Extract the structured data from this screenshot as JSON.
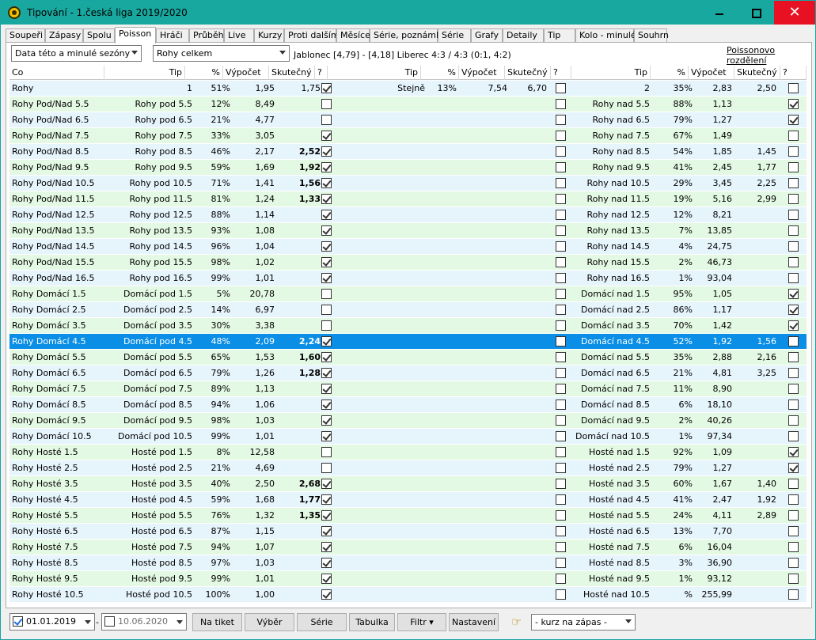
{
  "window": {
    "title": "Tipování - 1.česká liga 2019/2020",
    "minimize": "",
    "maximize": "",
    "close": "✕"
  },
  "tabs": [
    "Soupeři",
    "Zápasy",
    "Spolu",
    "Poisson",
    "Hráči",
    "Průběh",
    "Live",
    "Kurzy",
    "Proti dalším",
    "Měsíce",
    "Série, poznámky",
    "Série",
    "Grafy",
    "Detaily",
    "Tip",
    "Kolo - minulé",
    "Souhrn"
  ],
  "active_tab": "Poisson",
  "filters": {
    "data_source": "Data této a minulé sezóny",
    "market": "Rohy celkem",
    "match_info": "Jablonec [4,79] - [4,18] Liberec  4:3 / 4:3 (0:1, 4:2)",
    "poisson_link": "Poissonovo rozdělení"
  },
  "grid_headers": {
    "co": "Co",
    "tip": "Tip",
    "pct": "%",
    "calc": "Výpočet",
    "actual": "Skutečný",
    "q": "?"
  },
  "rows": [
    [
      "Rohy",
      "1",
      "51%",
      "1,95",
      "1,75",
      1,
      0,
      "Stejně",
      "13%",
      "7,54",
      "6,70",
      0,
      "2",
      "35%",
      "2,83",
      "2,50",
      0,
      0
    ],
    [
      "Rohy Pod/Nad 5.5",
      "Rohy pod 5.5",
      "12%",
      "8,49",
      "",
      0,
      0,
      "",
      "",
      "",
      "",
      0,
      "Rohy nad 5.5",
      "88%",
      "1,13",
      "",
      1,
      0
    ],
    [
      "Rohy Pod/Nad 6.5",
      "Rohy pod 6.5",
      "21%",
      "4,77",
      "",
      0,
      0,
      "",
      "",
      "",
      "",
      0,
      "Rohy nad 6.5",
      "79%",
      "1,27",
      "",
      1,
      0
    ],
    [
      "Rohy Pod/Nad 7.5",
      "Rohy pod 7.5",
      "33%",
      "3,05",
      "",
      1,
      0,
      "",
      "",
      "",
      "",
      0,
      "Rohy nad 7.5",
      "67%",
      "1,49",
      "",
      0,
      0
    ],
    [
      "Rohy Pod/Nad 8.5",
      "Rohy pod 8.5",
      "46%",
      "2,17",
      "2,52",
      1,
      1,
      "",
      "",
      "",
      "",
      0,
      "Rohy nad 8.5",
      "54%",
      "1,85",
      "1,45",
      0,
      0
    ],
    [
      "Rohy Pod/Nad 9.5",
      "Rohy pod 9.5",
      "59%",
      "1,69",
      "1,92",
      1,
      1,
      "",
      "",
      "",
      "",
      0,
      "Rohy nad 9.5",
      "41%",
      "2,45",
      "1,77",
      0,
      0
    ],
    [
      "Rohy Pod/Nad 10.5",
      "Rohy pod 10.5",
      "71%",
      "1,41",
      "1,56",
      1,
      1,
      "",
      "",
      "",
      "",
      0,
      "Rohy nad 10.5",
      "29%",
      "3,45",
      "2,25",
      0,
      0
    ],
    [
      "Rohy Pod/Nad 11.5",
      "Rohy pod 11.5",
      "81%",
      "1,24",
      "1,33",
      1,
      1,
      "",
      "",
      "",
      "",
      0,
      "Rohy nad 11.5",
      "19%",
      "5,16",
      "2,99",
      0,
      0
    ],
    [
      "Rohy Pod/Nad 12.5",
      "Rohy pod 12.5",
      "88%",
      "1,14",
      "",
      1,
      0,
      "",
      "",
      "",
      "",
      0,
      "Rohy nad 12.5",
      "12%",
      "8,21",
      "",
      0,
      0
    ],
    [
      "Rohy Pod/Nad 13.5",
      "Rohy pod 13.5",
      "93%",
      "1,08",
      "",
      1,
      0,
      "",
      "",
      "",
      "",
      0,
      "Rohy nad 13.5",
      "7%",
      "13,85",
      "",
      0,
      0
    ],
    [
      "Rohy Pod/Nad 14.5",
      "Rohy pod 14.5",
      "96%",
      "1,04",
      "",
      1,
      0,
      "",
      "",
      "",
      "",
      0,
      "Rohy nad 14.5",
      "4%",
      "24,75",
      "",
      0,
      0
    ],
    [
      "Rohy Pod/Nad 15.5",
      "Rohy pod 15.5",
      "98%",
      "1,02",
      "",
      1,
      0,
      "",
      "",
      "",
      "",
      0,
      "Rohy nad 15.5",
      "2%",
      "46,73",
      "",
      0,
      0
    ],
    [
      "Rohy Pod/Nad 16.5",
      "Rohy pod 16.5",
      "99%",
      "1,01",
      "",
      1,
      0,
      "",
      "",
      "",
      "",
      0,
      "Rohy nad 16.5",
      "1%",
      "93,04",
      "",
      0,
      0
    ],
    [
      "Rohy Domácí 1.5",
      "Domácí pod 1.5",
      "5%",
      "20,78",
      "",
      0,
      0,
      "",
      "",
      "",
      "",
      0,
      "Domácí nad 1.5",
      "95%",
      "1,05",
      "",
      1,
      0
    ],
    [
      "Rohy Domácí 2.5",
      "Domácí pod 2.5",
      "14%",
      "6,97",
      "",
      0,
      0,
      "",
      "",
      "",
      "",
      0,
      "Domácí nad 2.5",
      "86%",
      "1,17",
      "",
      1,
      0
    ],
    [
      "Rohy Domácí 3.5",
      "Domácí pod 3.5",
      "30%",
      "3,38",
      "",
      0,
      0,
      "",
      "",
      "",
      "",
      0,
      "Domácí nad 3.5",
      "70%",
      "1,42",
      "",
      1,
      0
    ],
    [
      "Rohy Domácí 4.5",
      "Domácí pod 4.5",
      "48%",
      "2,09",
      "2,24",
      1,
      1,
      "",
      "",
      "",
      "",
      0,
      "Domácí nad 4.5",
      "52%",
      "1,92",
      "1,56",
      0,
      0
    ],
    [
      "Rohy Domácí 5.5",
      "Domácí pod 5.5",
      "65%",
      "1,53",
      "1,60",
      1,
      1,
      "",
      "",
      "",
      "",
      0,
      "Domácí nad 5.5",
      "35%",
      "2,88",
      "2,16",
      0,
      0
    ],
    [
      "Rohy Domácí 6.5",
      "Domácí pod 6.5",
      "79%",
      "1,26",
      "1,28",
      1,
      1,
      "",
      "",
      "",
      "",
      0,
      "Domácí nad 6.5",
      "21%",
      "4,81",
      "3,25",
      0,
      0
    ],
    [
      "Rohy Domácí 7.5",
      "Domácí pod 7.5",
      "89%",
      "1,13",
      "",
      1,
      0,
      "",
      "",
      "",
      "",
      0,
      "Domácí nad 7.5",
      "11%",
      "8,90",
      "",
      0,
      0
    ],
    [
      "Rohy Domácí 8.5",
      "Domácí pod 8.5",
      "94%",
      "1,06",
      "",
      1,
      0,
      "",
      "",
      "",
      "",
      0,
      "Domácí nad 8.5",
      "6%",
      "18,10",
      "",
      0,
      0
    ],
    [
      "Rohy Domácí 9.5",
      "Domácí pod 9.5",
      "98%",
      "1,03",
      "",
      1,
      0,
      "",
      "",
      "",
      "",
      0,
      "Domácí nad 9.5",
      "2%",
      "40,26",
      "",
      0,
      0
    ],
    [
      "Rohy Domácí 10.5",
      "Domácí pod 10.5",
      "99%",
      "1,01",
      "",
      1,
      0,
      "",
      "",
      "",
      "",
      0,
      "Domácí nad 10.5",
      "1%",
      "97,34",
      "",
      0,
      0
    ],
    [
      "Rohy Hosté 1.5",
      "Hosté pod 1.5",
      "8%",
      "12,58",
      "",
      0,
      0,
      "",
      "",
      "",
      "",
      0,
      "Hosté nad 1.5",
      "92%",
      "1,09",
      "",
      1,
      0
    ],
    [
      "Rohy Hosté 2.5",
      "Hosté pod 2.5",
      "21%",
      "4,69",
      "",
      0,
      0,
      "",
      "",
      "",
      "",
      0,
      "Hosté nad 2.5",
      "79%",
      "1,27",
      "",
      1,
      0
    ],
    [
      "Rohy Hosté 3.5",
      "Hosté pod 3.5",
      "40%",
      "2,50",
      "2,68",
      1,
      1,
      "",
      "",
      "",
      "",
      0,
      "Hosté nad 3.5",
      "60%",
      "1,67",
      "1,40",
      0,
      0
    ],
    [
      "Rohy Hosté 4.5",
      "Hosté pod 4.5",
      "59%",
      "1,68",
      "1,77",
      1,
      1,
      "",
      "",
      "",
      "",
      0,
      "Hosté nad 4.5",
      "41%",
      "2,47",
      "1,92",
      0,
      0
    ],
    [
      "Rohy Hosté 5.5",
      "Hosté pod 5.5",
      "76%",
      "1,32",
      "1,35",
      1,
      1,
      "",
      "",
      "",
      "",
      0,
      "Hosté nad 5.5",
      "24%",
      "4,11",
      "2,89",
      0,
      0
    ],
    [
      "Rohy Hosté 6.5",
      "Hosté pod 6.5",
      "87%",
      "1,15",
      "",
      1,
      0,
      "",
      "",
      "",
      "",
      0,
      "Hosté nad 6.5",
      "13%",
      "7,70",
      "",
      0,
      0
    ],
    [
      "Rohy Hosté 7.5",
      "Hosté pod 7.5",
      "94%",
      "1,07",
      "",
      1,
      0,
      "",
      "",
      "",
      "",
      0,
      "Hosté nad 7.5",
      "6%",
      "16,04",
      "",
      0,
      0
    ],
    [
      "Rohy Hosté 8.5",
      "Hosté pod 8.5",
      "97%",
      "1,03",
      "",
      1,
      0,
      "",
      "",
      "",
      "",
      0,
      "Hosté nad 8.5",
      "3%",
      "36,90",
      "",
      0,
      0
    ],
    [
      "Rohy Hosté 9.5",
      "Hosté pod 9.5",
      "99%",
      "1,01",
      "",
      1,
      0,
      "",
      "",
      "",
      "",
      0,
      "Hosté nad 9.5",
      "1%",
      "93,12",
      "",
      0,
      0
    ],
    [
      "Rohy Hosté 10.5",
      "Hosté pod 10.5",
      "100%",
      "1,00",
      "",
      1,
      0,
      "",
      "",
      "",
      "",
      0,
      "Hosté nad 10.5",
      "%",
      "255,99",
      "",
      0,
      0
    ]
  ],
  "selected_row": 16,
  "bottom": {
    "date_from": "01.01.2019",
    "date_from_checked": true,
    "date_sep": "-",
    "date_to": "10.06.2020",
    "date_to_checked": false,
    "btn_ticket": "Na tiket",
    "btn_select": "Výběr",
    "btn_series": "Série",
    "btn_table": "Tabulka",
    "btn_filter": "Filtr ▾",
    "btn_settings": "Nastavení",
    "pointer_icon": "☞",
    "odds_combo": "- kurz na zápas -"
  }
}
